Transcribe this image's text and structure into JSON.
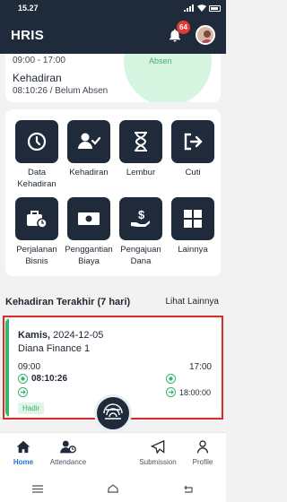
{
  "status_bar": {
    "time": "15.27"
  },
  "header": {
    "title": "HRIS",
    "notification_count": "64"
  },
  "top_card": {
    "shift": "09:00 - 17:00",
    "absen_label": "Absen",
    "title": "Kehadiran",
    "time_status": "08:10:26 / Belum Absen"
  },
  "menu": {
    "items": [
      {
        "label": "Data Kehadiran",
        "icon": "clock-icon"
      },
      {
        "label": "Kehadiran",
        "icon": "user-check-icon"
      },
      {
        "label": "Lembur",
        "icon": "hourglass-icon"
      },
      {
        "label": "Cuti",
        "icon": "exit-icon"
      },
      {
        "label": "Perjalanan Bisnis",
        "icon": "briefcase-clock-icon"
      },
      {
        "label": "Penggantian Biaya",
        "icon": "money-icon"
      },
      {
        "label": "Pengajuan Dana",
        "icon": "hand-money-icon"
      },
      {
        "label": "Lainnya",
        "icon": "grid-icon"
      }
    ]
  },
  "recent": {
    "title": "Kehadiran Terakhir (7 hari)",
    "see_more": "Lihat Lainnya",
    "card": {
      "day": "Kamis,",
      "date": "2024-12-05",
      "company": "Diana Finance 1",
      "start": "09:00",
      "end": "17:00",
      "check_in": "08:10:26",
      "check_out": "18:00:00",
      "status": "Hadir"
    }
  },
  "bottom_nav": {
    "items": [
      {
        "label": "Home",
        "icon": "home-icon"
      },
      {
        "label": "Attendance",
        "icon": "attendance-icon"
      },
      {
        "label": "Submission",
        "icon": "send-icon"
      },
      {
        "label": "Profile",
        "icon": "person-icon"
      }
    ]
  },
  "colors": {
    "primary": "#1f2b3a",
    "accent": "#3bb36c",
    "active": "#1976d2",
    "badge": "#e53935"
  }
}
